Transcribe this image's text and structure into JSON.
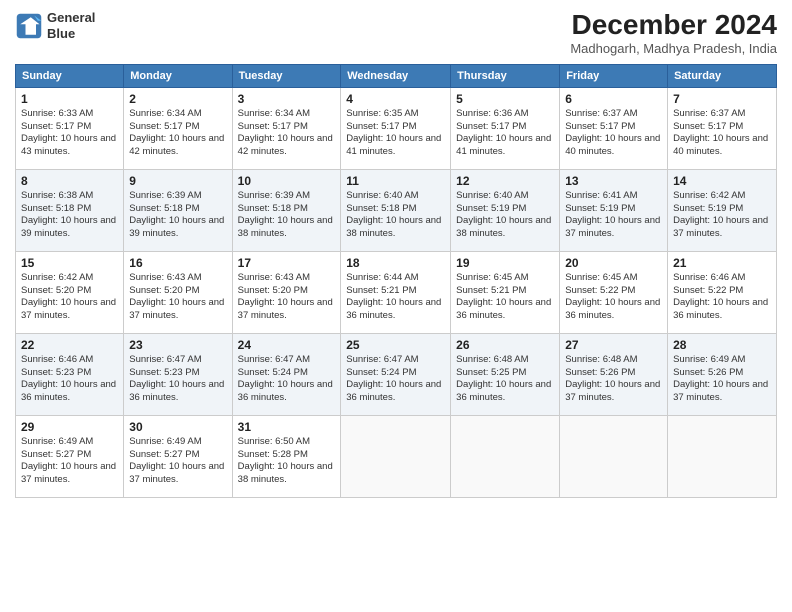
{
  "header": {
    "logo_line1": "General",
    "logo_line2": "Blue",
    "month_year": "December 2024",
    "location": "Madhogarh, Madhya Pradesh, India"
  },
  "columns": [
    "Sunday",
    "Monday",
    "Tuesday",
    "Wednesday",
    "Thursday",
    "Friday",
    "Saturday"
  ],
  "weeks": [
    [
      {
        "day": "1",
        "sunrise": "6:33 AM",
        "sunset": "5:17 PM",
        "daylight": "10 hours and 43 minutes."
      },
      {
        "day": "2",
        "sunrise": "6:34 AM",
        "sunset": "5:17 PM",
        "daylight": "10 hours and 42 minutes."
      },
      {
        "day": "3",
        "sunrise": "6:34 AM",
        "sunset": "5:17 PM",
        "daylight": "10 hours and 42 minutes."
      },
      {
        "day": "4",
        "sunrise": "6:35 AM",
        "sunset": "5:17 PM",
        "daylight": "10 hours and 41 minutes."
      },
      {
        "day": "5",
        "sunrise": "6:36 AM",
        "sunset": "5:17 PM",
        "daylight": "10 hours and 41 minutes."
      },
      {
        "day": "6",
        "sunrise": "6:37 AM",
        "sunset": "5:17 PM",
        "daylight": "10 hours and 40 minutes."
      },
      {
        "day": "7",
        "sunrise": "6:37 AM",
        "sunset": "5:17 PM",
        "daylight": "10 hours and 40 minutes."
      }
    ],
    [
      {
        "day": "8",
        "sunrise": "6:38 AM",
        "sunset": "5:18 PM",
        "daylight": "10 hours and 39 minutes."
      },
      {
        "day": "9",
        "sunrise": "6:39 AM",
        "sunset": "5:18 PM",
        "daylight": "10 hours and 39 minutes."
      },
      {
        "day": "10",
        "sunrise": "6:39 AM",
        "sunset": "5:18 PM",
        "daylight": "10 hours and 38 minutes."
      },
      {
        "day": "11",
        "sunrise": "6:40 AM",
        "sunset": "5:18 PM",
        "daylight": "10 hours and 38 minutes."
      },
      {
        "day": "12",
        "sunrise": "6:40 AM",
        "sunset": "5:19 PM",
        "daylight": "10 hours and 38 minutes."
      },
      {
        "day": "13",
        "sunrise": "6:41 AM",
        "sunset": "5:19 PM",
        "daylight": "10 hours and 37 minutes."
      },
      {
        "day": "14",
        "sunrise": "6:42 AM",
        "sunset": "5:19 PM",
        "daylight": "10 hours and 37 minutes."
      }
    ],
    [
      {
        "day": "15",
        "sunrise": "6:42 AM",
        "sunset": "5:20 PM",
        "daylight": "10 hours and 37 minutes."
      },
      {
        "day": "16",
        "sunrise": "6:43 AM",
        "sunset": "5:20 PM",
        "daylight": "10 hours and 37 minutes."
      },
      {
        "day": "17",
        "sunrise": "6:43 AM",
        "sunset": "5:20 PM",
        "daylight": "10 hours and 37 minutes."
      },
      {
        "day": "18",
        "sunrise": "6:44 AM",
        "sunset": "5:21 PM",
        "daylight": "10 hours and 36 minutes."
      },
      {
        "day": "19",
        "sunrise": "6:45 AM",
        "sunset": "5:21 PM",
        "daylight": "10 hours and 36 minutes."
      },
      {
        "day": "20",
        "sunrise": "6:45 AM",
        "sunset": "5:22 PM",
        "daylight": "10 hours and 36 minutes."
      },
      {
        "day": "21",
        "sunrise": "6:46 AM",
        "sunset": "5:22 PM",
        "daylight": "10 hours and 36 minutes."
      }
    ],
    [
      {
        "day": "22",
        "sunrise": "6:46 AM",
        "sunset": "5:23 PM",
        "daylight": "10 hours and 36 minutes."
      },
      {
        "day": "23",
        "sunrise": "6:47 AM",
        "sunset": "5:23 PM",
        "daylight": "10 hours and 36 minutes."
      },
      {
        "day": "24",
        "sunrise": "6:47 AM",
        "sunset": "5:24 PM",
        "daylight": "10 hours and 36 minutes."
      },
      {
        "day": "25",
        "sunrise": "6:47 AM",
        "sunset": "5:24 PM",
        "daylight": "10 hours and 36 minutes."
      },
      {
        "day": "26",
        "sunrise": "6:48 AM",
        "sunset": "5:25 PM",
        "daylight": "10 hours and 36 minutes."
      },
      {
        "day": "27",
        "sunrise": "6:48 AM",
        "sunset": "5:26 PM",
        "daylight": "10 hours and 37 minutes."
      },
      {
        "day": "28",
        "sunrise": "6:49 AM",
        "sunset": "5:26 PM",
        "daylight": "10 hours and 37 minutes."
      }
    ],
    [
      {
        "day": "29",
        "sunrise": "6:49 AM",
        "sunset": "5:27 PM",
        "daylight": "10 hours and 37 minutes."
      },
      {
        "day": "30",
        "sunrise": "6:49 AM",
        "sunset": "5:27 PM",
        "daylight": "10 hours and 37 minutes."
      },
      {
        "day": "31",
        "sunrise": "6:50 AM",
        "sunset": "5:28 PM",
        "daylight": "10 hours and 38 minutes."
      },
      null,
      null,
      null,
      null
    ]
  ]
}
